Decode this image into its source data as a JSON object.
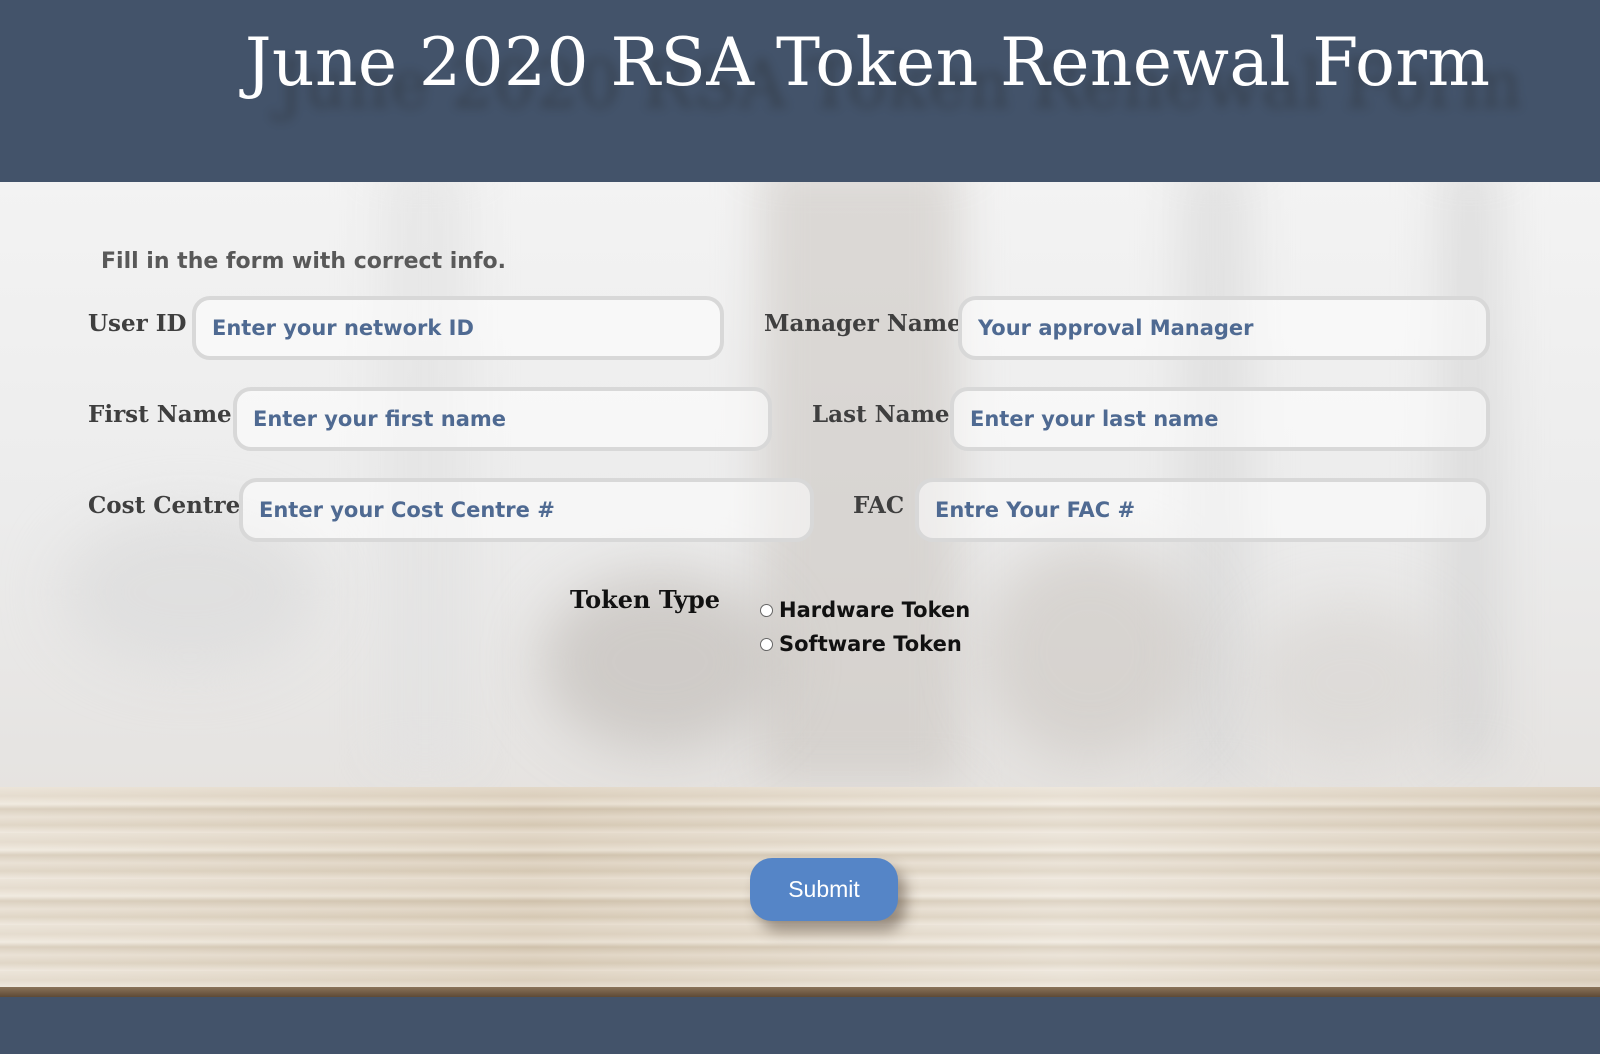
{
  "page": {
    "title": "June 2020 RSA Token Renewal Form",
    "intro": "Fill in the form with correct info."
  },
  "form": {
    "user_id": {
      "label": "User ID",
      "placeholder": "Enter your network ID"
    },
    "manager_name": {
      "label": "Manager Name",
      "placeholder": "Your approval Manager"
    },
    "first_name": {
      "label": "First Name",
      "placeholder": "Enter your first name"
    },
    "last_name": {
      "label": "Last Name",
      "placeholder": "Enter your last name"
    },
    "cost_centre": {
      "label": "Cost Centre",
      "placeholder": "Enter your Cost Centre #"
    },
    "fac": {
      "label": "FAC",
      "placeholder": "Entre Your FAC #"
    },
    "token_type": {
      "label": "Token Type",
      "options": [
        "Hardware Token",
        "Software Token"
      ],
      "selected": null
    },
    "submit_label": "Submit"
  },
  "colors": {
    "header_bg": "#43536a",
    "placeholder_text": "#4f6a92",
    "submit_bg": "#5585c7"
  }
}
